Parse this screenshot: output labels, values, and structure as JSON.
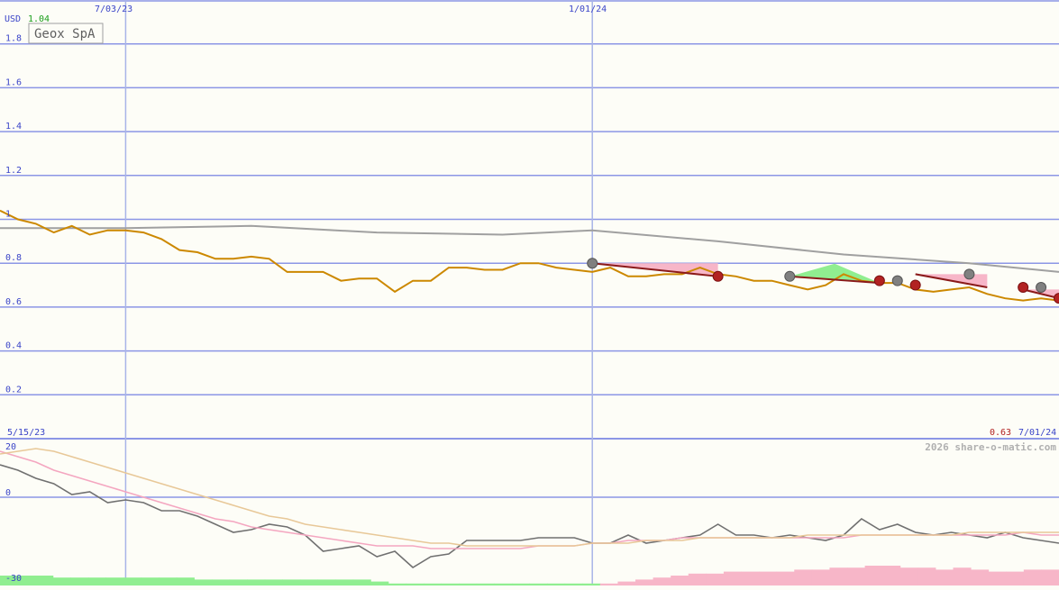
{
  "header": {
    "currency": "USD",
    "last_price": "1.04",
    "stock_name": "Geox SpA"
  },
  "footer": {
    "start_date": "5/15/23",
    "end_price": "0.63",
    "end_date": "7/01/24",
    "credit": "2026 share-o-matic.com"
  },
  "colors": {
    "background": "#fdfdf7",
    "grid": "#8c96e6",
    "date_line": "#a8b4e8",
    "axis_text": "#3b45c8",
    "price": "#cc8800",
    "ma_long": "#a0a0a0",
    "trend": "#8b1a1a",
    "marker_red": "#b22222",
    "marker_grey": "#808080",
    "fill_pink": "#f7b6c8",
    "fill_green": "#90ee90",
    "osc_dark": "#707070",
    "osc_pink": "#f4a6c0",
    "osc_tan": "#e8c898",
    "green_text": "#1a9e1a",
    "red_text": "#b22222",
    "credit_text": "#b0b0b0"
  },
  "chart_data": [
    {
      "type": "line",
      "title": "Geox SpA",
      "ylabel": "USD",
      "ylim": [
        0,
        1.9
      ],
      "y_ticks": [
        "1.8",
        "1.6",
        "1.4",
        "1.2",
        "1",
        "0.8",
        "0.6",
        "0.4",
        "0.2"
      ],
      "x_ticks": [
        "7/03/23",
        "1/01/24"
      ],
      "grid": true,
      "series": [
        {
          "key": "price",
          "x": [
            "5/15/23",
            "5/22/23",
            "5/29/23",
            "6/05/23",
            "6/12/23",
            "6/19/23",
            "6/26/23",
            "7/03/23",
            "7/10/23",
            "7/17/23",
            "7/24/23",
            "7/31/23",
            "8/07/23",
            "8/14/23",
            "8/21/23",
            "8/28/23",
            "9/04/23",
            "9/11/23",
            "9/18/23",
            "9/25/23",
            "10/02/23",
            "10/09/23",
            "10/16/23",
            "10/23/23",
            "10/30/23",
            "11/06/23",
            "11/13/23",
            "11/20/23",
            "11/27/23",
            "12/04/23",
            "12/11/23",
            "12/18/23",
            "12/25/23",
            "1/01/24",
            "1/08/24",
            "1/15/24",
            "1/22/24",
            "1/29/24",
            "2/05/24",
            "2/12/24",
            "2/19/24",
            "2/26/24",
            "3/04/24",
            "3/11/24",
            "3/18/24",
            "3/25/24",
            "4/01/24",
            "4/08/24",
            "4/15/24",
            "4/22/24",
            "4/29/24",
            "5/06/24",
            "5/13/24",
            "5/20/24",
            "5/27/24",
            "6/03/24",
            "6/10/24",
            "6/17/24",
            "6/24/24",
            "7/01/24"
          ],
          "values": [
            1.04,
            1.0,
            0.98,
            0.94,
            0.97,
            0.93,
            0.95,
            0.95,
            0.94,
            0.91,
            0.86,
            0.85,
            0.82,
            0.82,
            0.83,
            0.82,
            0.76,
            0.76,
            0.76,
            0.72,
            0.73,
            0.73,
            0.67,
            0.72,
            0.72,
            0.78,
            0.78,
            0.77,
            0.77,
            0.8,
            0.8,
            0.78,
            0.77,
            0.76,
            0.78,
            0.74,
            0.74,
            0.75,
            0.75,
            0.78,
            0.75,
            0.74,
            0.72,
            0.72,
            0.7,
            0.68,
            0.7,
            0.75,
            0.72,
            0.71,
            0.71,
            0.68,
            0.67,
            0.68,
            0.69,
            0.66,
            0.64,
            0.63,
            0.64,
            0.63
          ]
        },
        {
          "key": "moving_average",
          "x": [
            "5/15/23",
            "7/03/23",
            "8/21/23",
            "10/09/23",
            "11/27/23",
            "1/01/24",
            "2/19/24",
            "4/08/24",
            "5/27/24",
            "7/01/24"
          ],
          "values": [
            0.96,
            0.96,
            0.97,
            0.94,
            0.93,
            0.95,
            0.9,
            0.84,
            0.8,
            0.76
          ]
        }
      ],
      "trend_segments": [
        {
          "from": [
            "1/01/24",
            0.8
          ],
          "to": [
            "2/19/24",
            0.74
          ],
          "shade": "pink"
        },
        {
          "from": [
            "3/18/24",
            0.74
          ],
          "to": [
            "4/22/24",
            0.71
          ],
          "shade": "green"
        },
        {
          "from": [
            "5/06/24",
            0.75
          ],
          "to": [
            "6/03/24",
            0.69
          ],
          "shade": "pink"
        },
        {
          "from": [
            "6/17/24",
            0.68
          ],
          "to": [
            "7/01/24",
            0.64
          ],
          "shade": "pink"
        }
      ],
      "markers": [
        {
          "x": "1/01/24",
          "y": 0.8,
          "kind": "grey"
        },
        {
          "x": "2/19/24",
          "y": 0.74,
          "kind": "red"
        },
        {
          "x": "3/18/24",
          "y": 0.74,
          "kind": "grey"
        },
        {
          "x": "4/22/24",
          "y": 0.72,
          "kind": "red"
        },
        {
          "x": "4/29/24",
          "y": 0.72,
          "kind": "grey"
        },
        {
          "x": "5/06/24",
          "y": 0.7,
          "kind": "red"
        },
        {
          "x": "5/27/24",
          "y": 0.75,
          "kind": "grey"
        },
        {
          "x": "6/17/24",
          "y": 0.69,
          "kind": "red"
        },
        {
          "x": "6/24/24",
          "y": 0.69,
          "kind": "grey"
        },
        {
          "x": "7/01/24",
          "y": 0.64,
          "kind": "red"
        }
      ]
    },
    {
      "type": "line",
      "ylim": [
        -30,
        20
      ],
      "y_ticks": [
        "20",
        "0",
        "-30"
      ],
      "series": [
        {
          "key": "oscillator",
          "values": [
            12,
            10,
            7,
            5,
            1,
            2,
            -2,
            -1,
            -2,
            -5,
            -5,
            -7,
            -10,
            -13,
            -12,
            -10,
            -11,
            -14,
            -20,
            -19,
            -18,
            -22,
            -20,
            -26,
            -22,
            -21,
            -16,
            -16,
            -16,
            -16,
            -15,
            -15,
            -15,
            -17,
            -17,
            -14,
            -17,
            -16,
            -15,
            -14,
            -10,
            -14,
            -14,
            -15,
            -14,
            -15,
            -16,
            -14,
            -8,
            -12,
            -10,
            -13,
            -14,
            -13,
            -14,
            -15,
            -13,
            -15,
            -16,
            -17
          ]
        },
        {
          "key": "signal_pink",
          "values": [
            17,
            15,
            13,
            10,
            8,
            6,
            4,
            2,
            0,
            -2,
            -4,
            -6,
            -8,
            -9,
            -11,
            -12,
            -13,
            -14,
            -15,
            -16,
            -17,
            -18,
            -18,
            -18,
            -19,
            -19,
            -19,
            -19,
            -19,
            -19,
            -18,
            -18,
            -18,
            -17,
            -17,
            -16,
            -16,
            -16,
            -15,
            -15,
            -15,
            -15,
            -15,
            -15,
            -15,
            -15,
            -15,
            -15,
            -14,
            -14,
            -14,
            -14,
            -14,
            -14,
            -14,
            -14,
            -14,
            -13,
            -14,
            -14
          ]
        },
        {
          "key": "signal_tan",
          "values": [
            16,
            17,
            18,
            17,
            15,
            13,
            11,
            9,
            7,
            5,
            3,
            1,
            -1,
            -3,
            -5,
            -7,
            -8,
            -10,
            -11,
            -12,
            -13,
            -14,
            -15,
            -16,
            -17,
            -17,
            -18,
            -18,
            -18,
            -18,
            -18,
            -18,
            -18,
            -17,
            -17,
            -17,
            -16,
            -16,
            -16,
            -15,
            -15,
            -15,
            -15,
            -15,
            -15,
            -14,
            -14,
            -14,
            -14,
            -14,
            -14,
            -14,
            -14,
            -14,
            -13,
            -13,
            -13,
            -13,
            -13,
            -13
          ]
        }
      ],
      "histogram": [
        -5,
        -5,
        -5,
        -4,
        -4,
        -4,
        -4,
        -4,
        -4,
        -4,
        -4,
        -3,
        -3,
        -3,
        -3,
        -3,
        -3,
        -3,
        -3,
        -3,
        -3,
        -2,
        -1,
        -1,
        -1,
        -1,
        -1,
        -1,
        -1,
        -1,
        -1,
        -1,
        -1,
        -1,
        1,
        2,
        3,
        4,
        5,
        6,
        6,
        7,
        7,
        7,
        7,
        8,
        8,
        9,
        9,
        10,
        10,
        9,
        9,
        8,
        9,
        8,
        7,
        7,
        8,
        8
      ]
    }
  ]
}
